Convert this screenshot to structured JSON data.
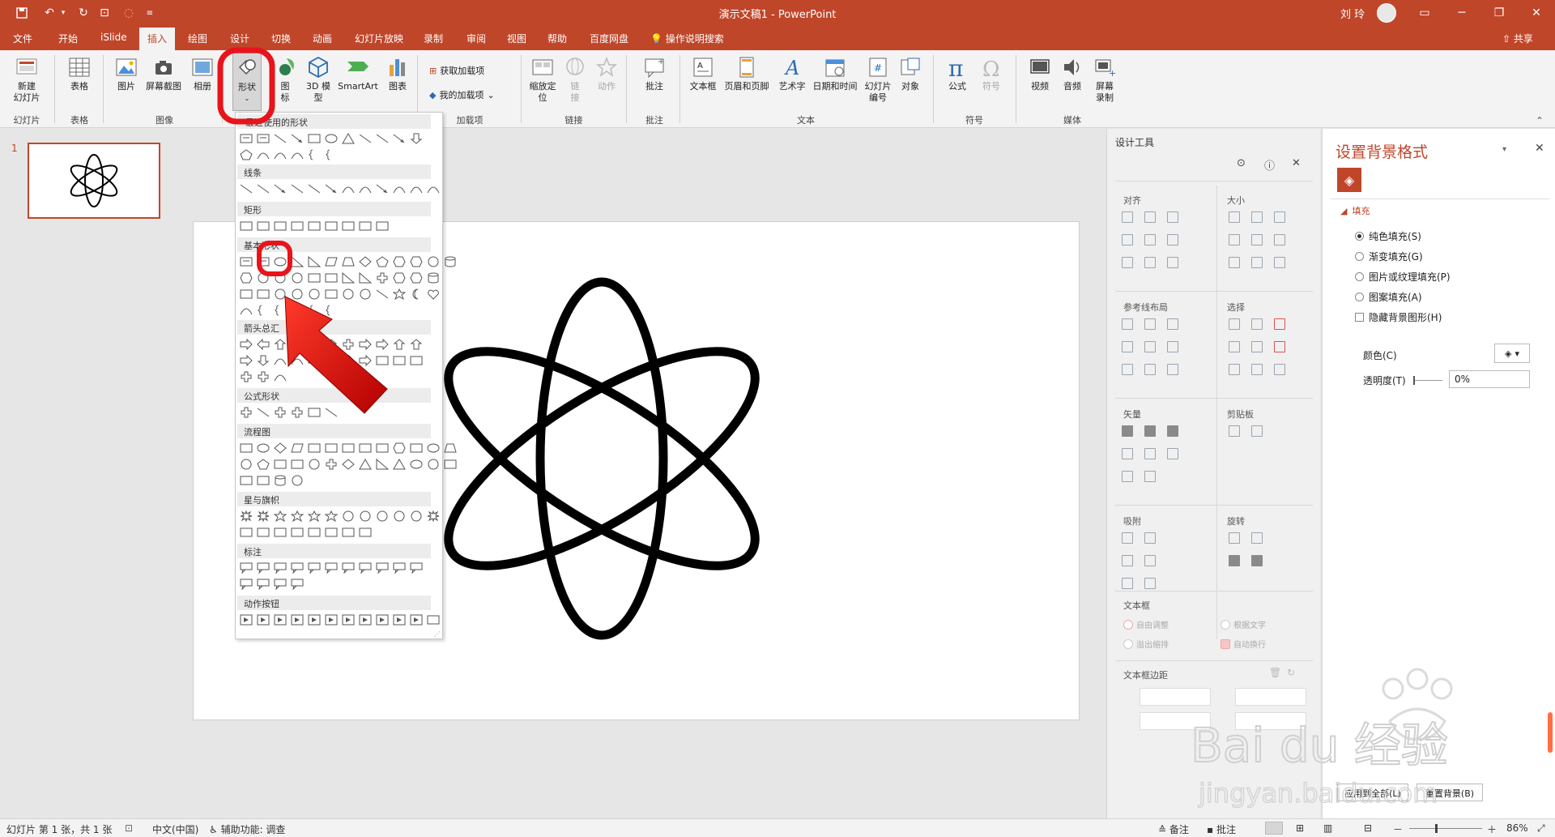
{
  "window": {
    "title": "演示文稿1 - PowerPoint",
    "user": "刘 玲"
  },
  "tabs": [
    "文件",
    "开始",
    "iSlide",
    "插入",
    "绘图",
    "设计",
    "切换",
    "动画",
    "幻灯片放映",
    "录制",
    "审阅",
    "视图",
    "帮助",
    "百度网盘"
  ],
  "active_tab": "插入",
  "tell_me": "操作说明搜索",
  "share": "共享",
  "ribbon": {
    "new_slide": "新建\n幻灯片",
    "table": "表格",
    "picture": "图片",
    "screenshot": "屏幕截图",
    "album": "相册",
    "shapes": "形状",
    "icons": "图\n标",
    "model3d": "3D 模\n型",
    "smartart": "SmartArt",
    "chart": "图表",
    "get_addins": "获取加载项",
    "my_addins": "我的加载项",
    "zoom": "缩放定\n位",
    "link": "链\n接",
    "action": "动作",
    "comment": "批注",
    "textbox": "文本框",
    "header_footer": "页眉和页脚",
    "wordart": "艺术字",
    "date_time": "日期和时间",
    "slide_number": "幻灯片\n编号",
    "object": "对象",
    "equation": "公式",
    "symbol": "符号",
    "video": "视频",
    "audio": "音频",
    "screen_record": "屏幕\n录制",
    "groups": {
      "slides": "幻灯片",
      "tables": "表格",
      "images": "图像",
      "addins": "加载项",
      "links": "链接",
      "comments": "批注",
      "text": "文本",
      "symbols": "符号",
      "media": "媒体"
    }
  },
  "slide_pane": {
    "number": "1"
  },
  "gallery": {
    "categories": [
      "最近使用的形状",
      "线条",
      "矩形",
      "基本形状",
      "箭头总汇",
      "公式形状",
      "流程图",
      "星与旗帜",
      "标注",
      "动作按钮"
    ]
  },
  "design_tools": {
    "title": "设计工具",
    "sections": {
      "align": "对齐",
      "size": "大小",
      "guides": "参考线布局",
      "select": "选择",
      "vector": "矢量",
      "clipboard": "剪贴板",
      "snap": "吸附",
      "rotate": "旋转",
      "textbox": "文本框",
      "margins": "文本框边距"
    },
    "textbox_options": [
      "自由调整",
      "根据文字",
      "溢出缩排",
      "自动换行"
    ]
  },
  "format_panel": {
    "title": "设置背景格式",
    "fill_section": "填充",
    "options": [
      {
        "label": "纯色填充(S)",
        "selected": true
      },
      {
        "label": "渐变填充(G)",
        "selected": false
      },
      {
        "label": "图片或纹理填充(P)",
        "selected": false
      },
      {
        "label": "图案填充(A)",
        "selected": false
      }
    ],
    "hide_bg": "隐藏背景图形(H)",
    "color_label": "颜色(C)",
    "transparency_label": "透明度(T)",
    "transparency_value": "0%",
    "apply_all": "应用到全部(L)",
    "reset": "重置背景(B)"
  },
  "status": {
    "slide_info": "幻灯片 第 1 张，共 1 张",
    "language": "中文(中国)",
    "accessibility": "辅助功能: 调查",
    "notes": "备注",
    "comments": "批注",
    "zoom": "86%"
  },
  "watermark": {
    "brand": "Bai du 经验",
    "url": "jingyan.baidu.com"
  },
  "colors": {
    "accent": "#c0462a",
    "highlight": "#e8141b"
  }
}
